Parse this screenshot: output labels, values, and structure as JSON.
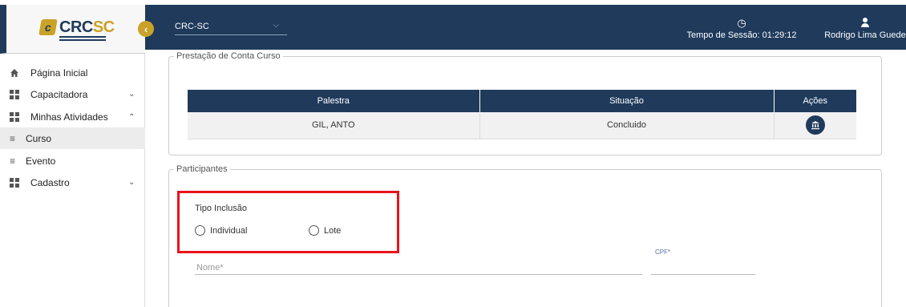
{
  "app": {
    "logo": {
      "mark": "c",
      "text_crc": "CRC",
      "text_sc": "SC"
    }
  },
  "colors": {
    "primary": "#1f3a5b",
    "accent": "#c9a227",
    "highlight": "#e8141c"
  },
  "header": {
    "org": "CRC-SC",
    "session_label": "Tempo de Sessão: 01:29:12",
    "user_name": "Rodrigo Lima Guede"
  },
  "sidebar": {
    "collapse_icon": "chevron-left-icon",
    "items": [
      {
        "label": "Página Inicial",
        "icon": "home-icon"
      },
      {
        "label": "Capacitadora",
        "icon": "grid-icon",
        "chevron": "⌄"
      },
      {
        "label": "Minhas Atividades",
        "icon": "grid-icon",
        "chevron": "⌃"
      },
      {
        "label": "Curso",
        "icon": "list-icon"
      },
      {
        "label": "Evento",
        "icon": "list-icon"
      },
      {
        "label": "Cadastro",
        "icon": "grid-icon",
        "chevron": "⌄"
      }
    ]
  },
  "prestacao": {
    "legend": "Prestação de Conta Curso",
    "columns": [
      "Palestra",
      "Situação",
      "Ações"
    ],
    "rows": [
      {
        "palestra": "GIL, ANTO",
        "situacao": "Concluido",
        "action_icon": "bank-icon"
      }
    ]
  },
  "participantes": {
    "legend": "Participantes",
    "tipo_label": "Tipo Inclusão",
    "options": [
      "Individual",
      "Lote"
    ],
    "nome_placeholder": "Nome*",
    "cpf_label": "CPF*"
  }
}
